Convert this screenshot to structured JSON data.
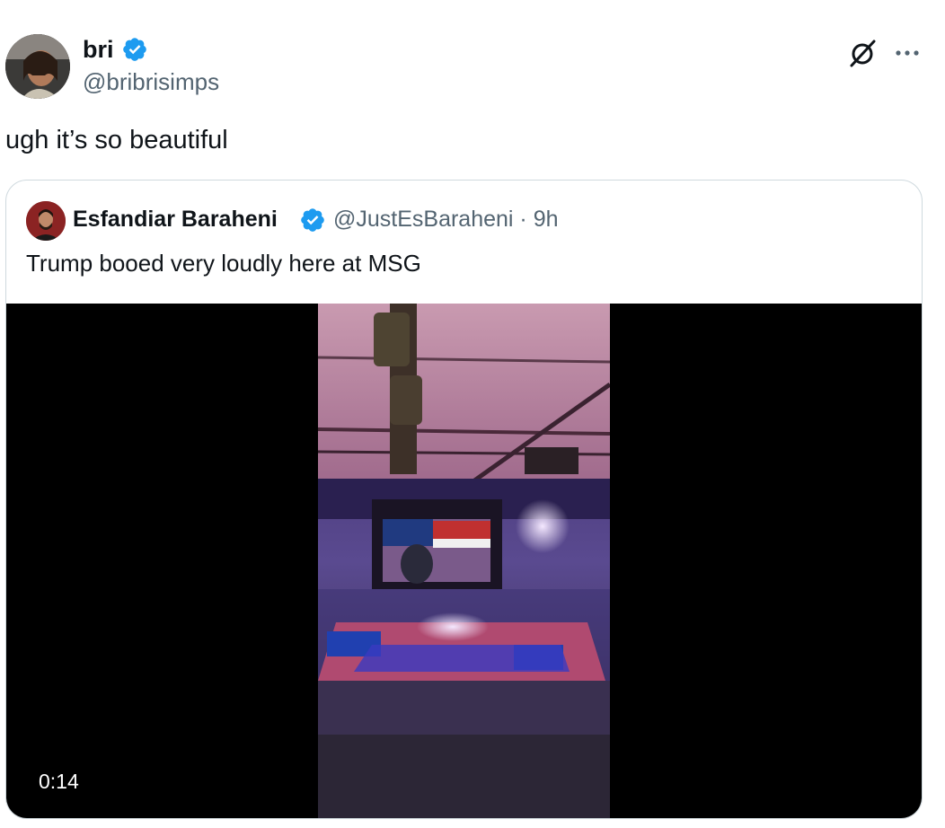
{
  "author": {
    "name": "bri",
    "handle": "@bribrisimps",
    "verified": true
  },
  "tweet": {
    "text": "ugh it’s so beautiful"
  },
  "quoted": {
    "name": "Esfandiar Baraheni",
    "handle_time": "@JustEsBaraheni · 9h",
    "verified": true,
    "text": "Trump booed very loudly here at MSG",
    "video": {
      "duration": "0:14"
    }
  },
  "icons": {
    "grok": "grok-icon",
    "more": "more-icon",
    "verified": "verified-badge-icon"
  },
  "colors": {
    "verified_blue": "#1d9bf0",
    "secondary_text": "#536471"
  }
}
